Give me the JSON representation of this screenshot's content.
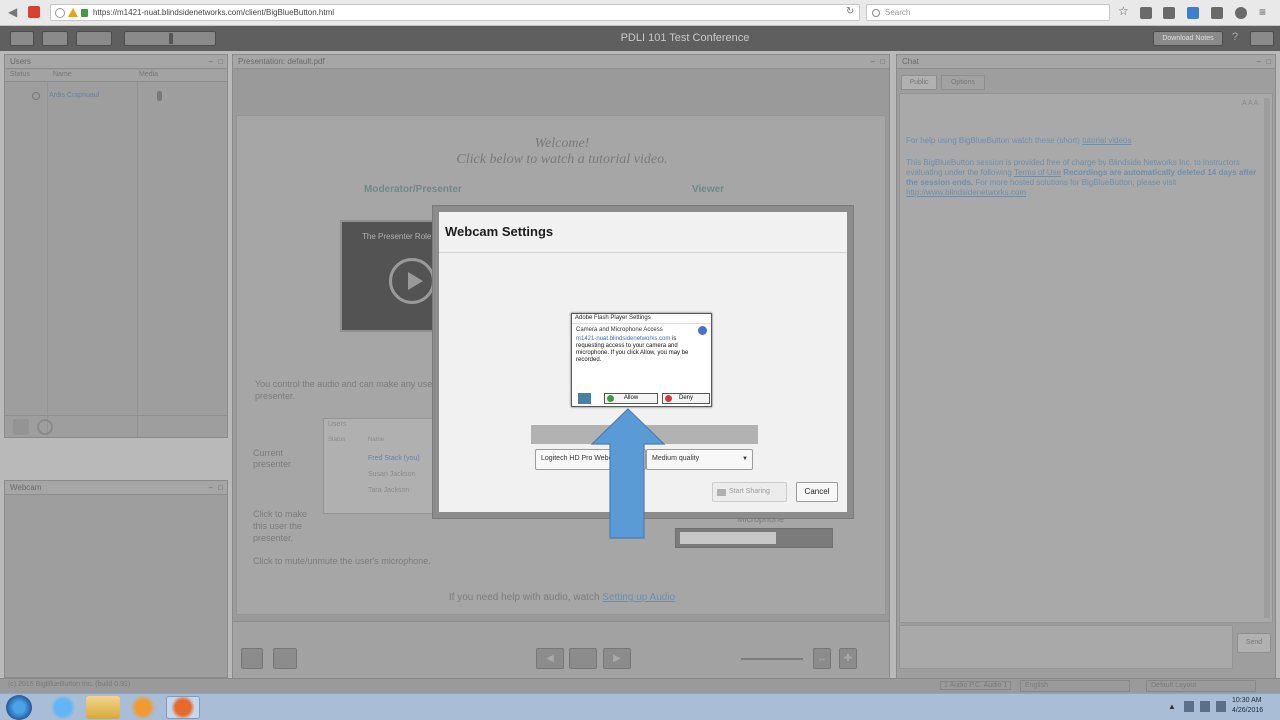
{
  "browser": {
    "url": "https://m1421-nuat.blindsidenetworks.com/client/BigBlueButton.html",
    "search_placeholder": "Search"
  },
  "app": {
    "title": "PDLI 101 Test Conference",
    "download_label": "Download Notes"
  },
  "users_panel": {
    "title": "Users",
    "columns": [
      "Status",
      "Name",
      "Media"
    ],
    "users": [
      {
        "name": "Ardis Crapnuaul"
      }
    ]
  },
  "webcam_panel": {
    "title": "Webcam"
  },
  "presentation": {
    "panel_title": "Presentation: default.pdf",
    "welcome": "Welcome!",
    "tutorial_line": "Click below to watch a tutorial video.",
    "moderator_label": "Moderator/Presenter",
    "viewer_label": "Viewer",
    "video_caption": "The Presenter Role",
    "control_text": "You control the audio and can make any user the presenter.",
    "current_presenter_label": "Current presenter",
    "click_make_presenter": "Click to make this user the presenter.",
    "mute_text": "Click to mute/unmute the user's microphone.",
    "audio_help_prefix": "If you need help with audio, watch",
    "audio_help_link": "Setting up Audio",
    "mini_panel_title": "Users",
    "mini_columns": [
      "Status",
      "Name"
    ],
    "mini_users": [
      "Fred Stack (you)",
      "Susan Jackson",
      "Tara Jackson"
    ],
    "microphone_label": "Microphone"
  },
  "chat": {
    "title": "Chat",
    "tabs": [
      "Public",
      "Options"
    ],
    "font_size": "A A A",
    "help_prefix": "For help using BigBlueButton watch these (short)",
    "help_link": "tutorial videos",
    "disclaimer_1": "This BigBlueButton session is provided free of charge by Blindside Networks Inc. to instructors evaluating under the following",
    "terms_link": "Terms of Use",
    "disclaimer_bold": "Recordings are automatically deleted 14 days after the session ends.",
    "disclaimer_2": "For more hosted solutions for BigBlueButton, please visit",
    "site_link": "http://www.blindsidenetworks.com",
    "send_label": "Send"
  },
  "status_bar": {
    "copyright": "(c) 2015 BigBlueButton Inc. (build 0.91)",
    "audio_label": "1 Audio P.C. Audio 1",
    "language": "English",
    "layout": "Default Layout"
  },
  "taskbar": {
    "time": "10:30 AM",
    "date": "4/26/2016"
  },
  "webcam_dialog": {
    "title": "Webcam Settings",
    "camera_option": "Logitech HD Pro Webcam C920",
    "quality_option": "Medium quality",
    "start_sharing_label": "Start Sharing",
    "cancel_label": "Cancel"
  },
  "flash_dialog": {
    "title": "Adobe Flash Player Settings",
    "subtitle": "Camera and Microphone Access",
    "body_link": "m1421-nuat.blindsidenetworks.com",
    "body_text": "is requesting access to your camera and microphone. If you click Allow, you may be recorded.",
    "allow_label": "Allow",
    "deny_label": "Deny"
  },
  "colors": {
    "arrow": "#5b9bd5",
    "link": "#6d8fae",
    "quality_text": "#b9a94a"
  }
}
